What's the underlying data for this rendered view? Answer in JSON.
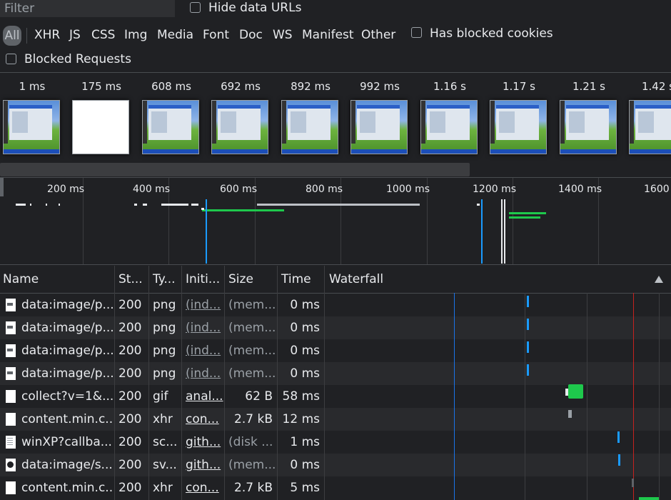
{
  "toolbar": {
    "filter_placeholder": "Filter",
    "hide_data_urls": "Hide data URLs",
    "types": [
      "All",
      "XHR",
      "JS",
      "CSS",
      "Img",
      "Media",
      "Font",
      "Doc",
      "WS",
      "Manifest",
      "Other"
    ],
    "has_blocked_cookies": "Has blocked cookies",
    "blocked_requests": "Blocked Requests"
  },
  "filmstrip": [
    {
      "time": "1 ms",
      "kind": "desktop"
    },
    {
      "time": "175 ms",
      "kind": "blank"
    },
    {
      "time": "608 ms",
      "kind": "desktop"
    },
    {
      "time": "692 ms",
      "kind": "desktop"
    },
    {
      "time": "892 ms",
      "kind": "desktop"
    },
    {
      "time": "992 ms",
      "kind": "desktop"
    },
    {
      "time": "1.16 s",
      "kind": "desktop"
    },
    {
      "time": "1.17 s",
      "kind": "desktop"
    },
    {
      "time": "1.21 s",
      "kind": "desktop"
    },
    {
      "time": "1.42 s",
      "kind": "desktop"
    }
  ],
  "overview": {
    "ticks": [
      "200 ms",
      "400 ms",
      "600 ms",
      "800 ms",
      "1000 ms",
      "1200 ms",
      "1400 ms",
      "1600 ms"
    ]
  },
  "table": {
    "headers": {
      "name": "Name",
      "status": "St...",
      "type": "Ty...",
      "initiator": "Initi...",
      "size": "Size",
      "time": "Time",
      "waterfall": "Waterfall"
    },
    "rows": [
      {
        "name": "data:image/p...",
        "status": "200",
        "type": "png",
        "initiator": "(ind...",
        "size": "(mem...",
        "time": "0 ms",
        "icon": "image-file-icon"
      },
      {
        "name": "data:image/p...",
        "status": "200",
        "type": "png",
        "initiator": "(ind...",
        "size": "(mem...",
        "time": "0 ms",
        "icon": "image-file-icon"
      },
      {
        "name": "data:image/p...",
        "status": "200",
        "type": "png",
        "initiator": "(ind...",
        "size": "(mem...",
        "time": "0 ms",
        "icon": "image-file-icon"
      },
      {
        "name": "data:image/p...",
        "status": "200",
        "type": "png",
        "initiator": "(ind...",
        "size": "(mem...",
        "time": "0 ms",
        "icon": "image-file-icon"
      },
      {
        "name": "collect?v=1&...",
        "status": "200",
        "type": "gif",
        "initiator": "anal...",
        "size": "62 B",
        "time": "58 ms",
        "icon": "blank-file-icon"
      },
      {
        "name": "content.min.c...",
        "status": "200",
        "type": "xhr",
        "initiator": "con...",
        "size": "2.7 kB",
        "time": "12 ms",
        "icon": "blank-file-icon"
      },
      {
        "name": "winXP?callba...",
        "status": "200",
        "type": "sc...",
        "initiator": "gith...",
        "size": "(disk ...",
        "time": "1 ms",
        "icon": "script-file-icon"
      },
      {
        "name": "data:image/s...",
        "status": "200",
        "type": "sv...",
        "initiator": "gith...",
        "size": "(mem...",
        "time": "0 ms",
        "icon": "github-icon"
      },
      {
        "name": "content.min.c...",
        "status": "200",
        "type": "xhr",
        "initiator": "con...",
        "size": "2.7 kB",
        "time": "5 ms",
        "icon": "blank-file-icon"
      }
    ]
  }
}
